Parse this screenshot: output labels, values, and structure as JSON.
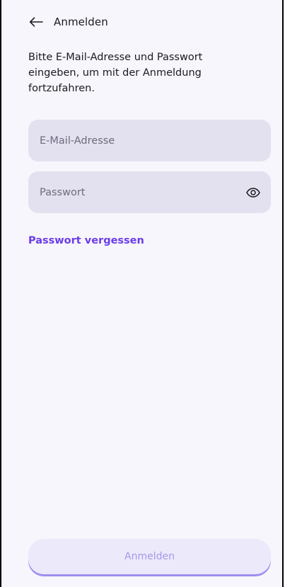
{
  "header": {
    "title": "Anmelden",
    "back_icon": "arrow-left-icon"
  },
  "instructions": "Bitte E-Mail-Adresse und Passwort eingeben, um mit der Anmeldung fortzufahren.",
  "email_field": {
    "placeholder": "E-Mail-Adresse",
    "value": ""
  },
  "password_field": {
    "placeholder": "Passwort",
    "value": "",
    "toggle_icon": "eye-icon"
  },
  "forgot_password": {
    "label": "Passwort vergessen"
  },
  "submit_button": {
    "label": "Anmelden",
    "enabled": false
  },
  "colors": {
    "background": "#f7f6fc",
    "field_background": "#e3e1f0",
    "accent": "#6a3de8",
    "button_background": "#ece9fb",
    "button_text": "#a798e9",
    "button_shadow": "#9f8ef0"
  }
}
